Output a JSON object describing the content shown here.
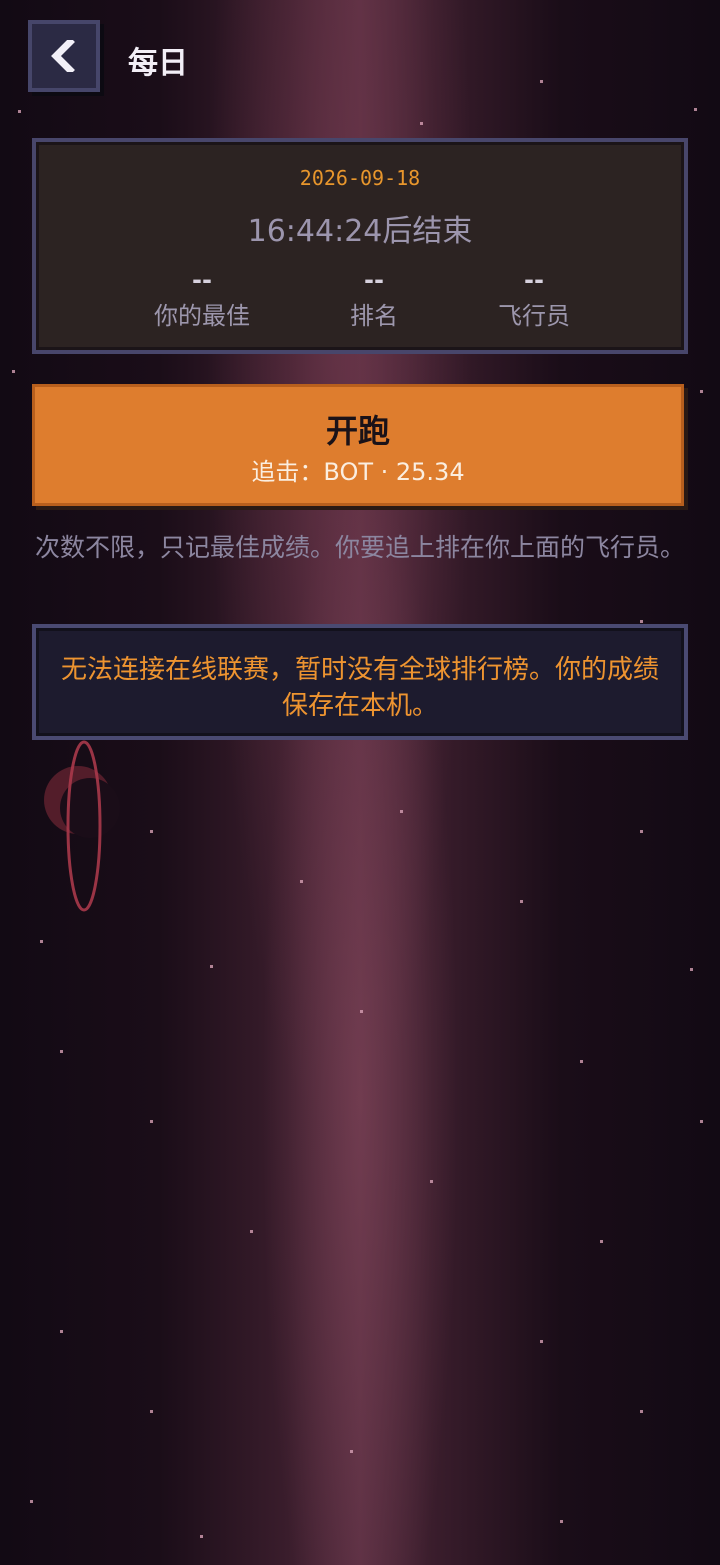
{
  "header": {
    "back_icon": "chevron-left-icon",
    "title": "每日"
  },
  "daily": {
    "date": "2026-09-18",
    "countdown": "16:44:24后结束",
    "stats": [
      {
        "value": "--",
        "label": "你的最佳"
      },
      {
        "value": "--",
        "label": "排名"
      },
      {
        "value": "--",
        "label": "飞行员"
      }
    ]
  },
  "start": {
    "label": "开跑",
    "sub": "追击：BOT · 25.34"
  },
  "hint": "次数不限，只记最佳成绩。你要追上排在你上面的飞行员。",
  "warning": "无法连接在线联赛，暂时没有全球排行榜。你的成绩保存在本机。",
  "colors": {
    "accent_orange": "#de7d2e",
    "date_orange": "#e8962c",
    "panel_border": "#48466b",
    "background": "#140a16"
  }
}
